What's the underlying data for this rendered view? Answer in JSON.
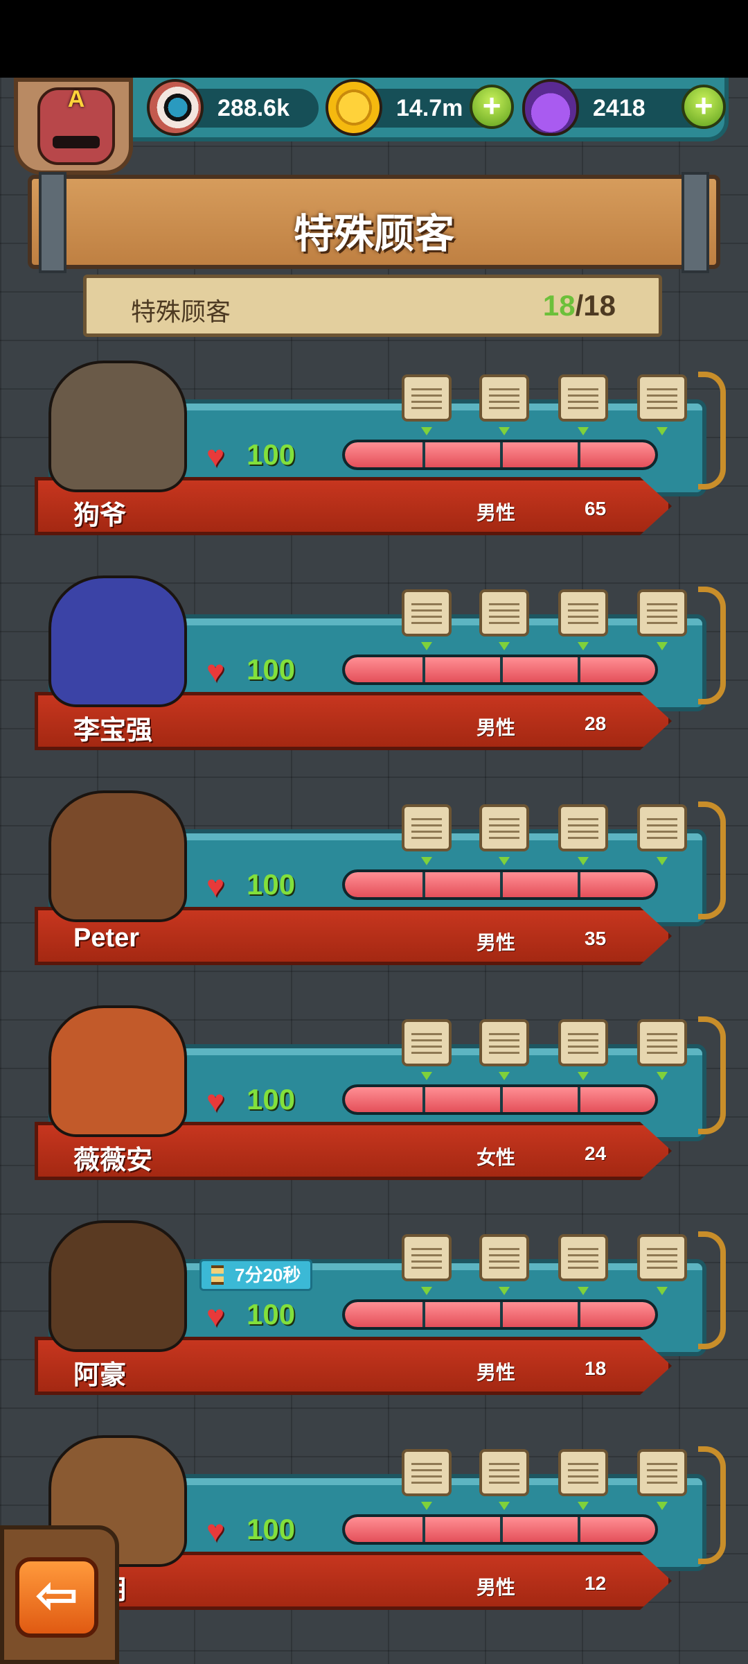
{
  "currencies": [
    {
      "name": "eyes",
      "icon": "eyeball-icon",
      "value": "288.6k"
    },
    {
      "name": "coins",
      "icon": "coin-icon",
      "value": "14.7m"
    },
    {
      "name": "potion",
      "icon": "potion-icon",
      "value": "2418"
    }
  ],
  "badge": {
    "letter": "A"
  },
  "title": "特殊顾客",
  "section": {
    "label": "特殊顾客",
    "current": "18",
    "total": "/18"
  },
  "customers": [
    {
      "name": "狗爷",
      "gender": "男性",
      "age": "65",
      "hp": "100",
      "hp_fraction": 1.0,
      "portrait_color": "#6a5a48"
    },
    {
      "name": "李宝强",
      "gender": "男性",
      "age": "28",
      "hp": "100",
      "hp_fraction": 1.0,
      "portrait_color": "#3b43a6"
    },
    {
      "name": "Peter",
      "gender": "男性",
      "age": "35",
      "hp": "100",
      "hp_fraction": 1.0,
      "portrait_color": "#7a4a2a"
    },
    {
      "name": "薇薇安",
      "gender": "女性",
      "age": "24",
      "hp": "100",
      "hp_fraction": 1.0,
      "portrait_color": "#c25a2a"
    },
    {
      "name": "阿豪",
      "gender": "男性",
      "age": "18",
      "hp": "100",
      "hp_fraction": 1.0,
      "portrait_color": "#5a3a22",
      "timer": "7分20秒"
    },
    {
      "name": "…明",
      "gender": "男性",
      "age": "12",
      "hp": "100",
      "hp_fraction": 1.0,
      "portrait_color": "#8a5a32"
    }
  ],
  "back_button": {
    "glyph": "⇦"
  }
}
